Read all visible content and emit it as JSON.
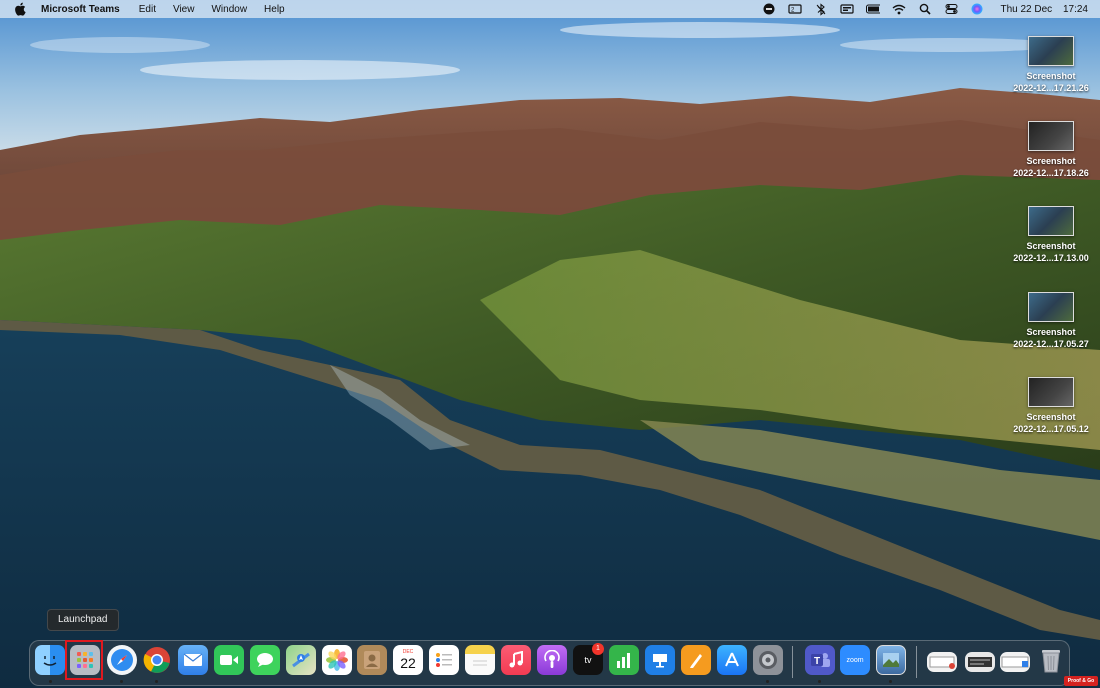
{
  "menubar": {
    "app_name": "Microsoft Teams",
    "menus": [
      "Edit",
      "View",
      "Window",
      "Help"
    ],
    "status_icons": [
      "screen-record-icon",
      "display-icon",
      "bluetooth-off-icon",
      "keyboard-input-icon",
      "battery-icon",
      "wifi-icon",
      "spotlight-search-icon",
      "control-center-icon",
      "siri-icon"
    ],
    "date": "Thu 22 Dec",
    "time": "17:24"
  },
  "desktop": {
    "files": [
      {
        "name": "Screenshot",
        "sub": "2022-12...17.21.26"
      },
      {
        "name": "Screenshot",
        "sub": "2022-12...17.18.26"
      },
      {
        "name": "Screenshot",
        "sub": "2022-12...17.13.00"
      },
      {
        "name": "Screenshot",
        "sub": "2022-12...17.05.27"
      },
      {
        "name": "Screenshot",
        "sub": "2022-12...17.05.12"
      }
    ]
  },
  "tooltip": {
    "label": "Launchpad"
  },
  "dock": {
    "apps": [
      {
        "name": "Finder",
        "icon": "finder-icon",
        "color": "#3ea2f5",
        "running": true
      },
      {
        "name": "Launchpad",
        "icon": "launchpad-icon",
        "color": "#8a8f98",
        "running": false
      },
      {
        "name": "Safari",
        "icon": "safari-icon",
        "color": "#2f8cf0",
        "running": true
      },
      {
        "name": "Chrome",
        "icon": "chrome-icon",
        "color": "#ffffff",
        "running": true
      },
      {
        "name": "Mail",
        "icon": "mail-icon",
        "color": "#3f8ef2",
        "running": false
      },
      {
        "name": "FaceTime",
        "icon": "facetime-icon",
        "color": "#31c759",
        "running": false
      },
      {
        "name": "Messages",
        "icon": "messages-icon",
        "color": "#3ed35c",
        "running": false
      },
      {
        "name": "Maps",
        "icon": "maps-icon",
        "color": "#6cc36a",
        "running": false
      },
      {
        "name": "Photos",
        "icon": "photos-icon",
        "color": "#ffffff",
        "running": false
      },
      {
        "name": "Contacts",
        "icon": "contacts-icon",
        "color": "#b08a5a",
        "running": false
      },
      {
        "name": "Calendar",
        "icon": "calendar-icon",
        "color": "#ffffff",
        "running": false,
        "month": "DEC",
        "day": "22"
      },
      {
        "name": "Reminders",
        "icon": "reminders-icon",
        "color": "#ffffff",
        "running": false
      },
      {
        "name": "Notes",
        "icon": "notes-icon",
        "color": "#f6d24c",
        "running": false
      },
      {
        "name": "Music",
        "icon": "music-icon",
        "color": "#f53d53",
        "running": false
      },
      {
        "name": "Podcasts",
        "icon": "podcasts-icon",
        "color": "#a24de0",
        "running": false
      },
      {
        "name": "TV",
        "icon": "tv-icon",
        "color": "#111111",
        "running": false,
        "label": "tv"
      },
      {
        "name": "Numbers",
        "icon": "numbers-icon",
        "color": "#34b54a",
        "running": false
      },
      {
        "name": "Keynote",
        "icon": "keynote-icon",
        "color": "#1f7fe6",
        "running": false
      },
      {
        "name": "Pages",
        "icon": "pages-icon",
        "color": "#f59b1f",
        "running": false
      },
      {
        "name": "App Store",
        "icon": "app-store-icon",
        "color": "#1a8cf5",
        "running": false
      },
      {
        "name": "System Preferences",
        "icon": "system-preferences-icon",
        "color": "#8e9299",
        "running": true
      },
      {
        "name": "Microsoft Teams",
        "icon": "teams-icon",
        "color": "#5059c9",
        "running": true
      },
      {
        "name": "Zoom",
        "icon": "zoom-icon",
        "color": "#2d8cff",
        "running": false,
        "label": "zoom"
      },
      {
        "name": "Preview",
        "icon": "preview-icon",
        "color": "#4a7db0",
        "running": true
      }
    ],
    "badge": "1",
    "stack_items": [
      "screenshot-stack-icon",
      "screenshot-stack-icon",
      "screenshot-stack-icon",
      "screenshot-stack-icon"
    ],
    "trash": {
      "icon": "trash-icon"
    }
  },
  "watermark": {
    "label": "Proof & Go"
  }
}
